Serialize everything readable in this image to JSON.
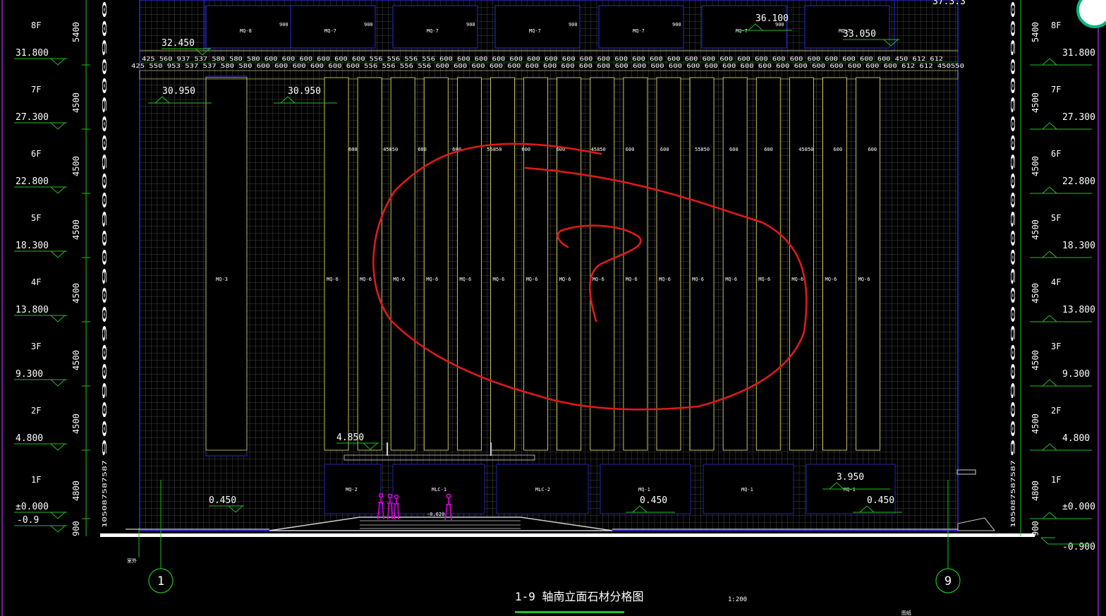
{
  "title": "1-9 轴南立面石材分格图",
  "scale": "1:200",
  "footer_note": "图纸",
  "north_label": "室外",
  "axes": [
    "1",
    "9"
  ],
  "floors": [
    {
      "name": "8F",
      "elev": "31.800",
      "height": "5400"
    },
    {
      "name": "7F",
      "elev": "27.300",
      "height": "4500"
    },
    {
      "name": "6F",
      "elev": "22.800",
      "height": "4500"
    },
    {
      "name": "5F",
      "elev": "18.300",
      "height": "4500"
    },
    {
      "name": "4F",
      "elev": "13.800",
      "height": "4500"
    },
    {
      "name": "3F",
      "elev": "9.300",
      "height": "4500"
    },
    {
      "name": "2F",
      "elev": "4.800",
      "height": "4500"
    },
    {
      "name": "1F",
      "elev": "±0.000",
      "height": "4800"
    }
  ],
  "base": {
    "left": "-0.9",
    "right": "-0.900",
    "height": "900"
  },
  "elev_marks": {
    "top_right": "36.100",
    "roof_right": "33.050",
    "roof_left": "32.450",
    "parapet_1": "30.950",
    "parapet_2": "30.950",
    "canopy": "4.850",
    "entry_right": "3.950",
    "sill_left": "0.450",
    "sill_mid": "0.450",
    "sill_right": "0.450",
    "entry_floor": "-0.020",
    "top_corner": "37.3.3"
  },
  "dim_row_1": "425 560 937 537 580 580 580 600 600 600 600 600 600 556 556 556 556 600 600 600 600 600 600 600 600 600 600 600 600 600 600 600 600 600 600 600 600 600 600 600 600 600 600 450 612 612",
  "dim_row_2": "425 550 953 537 537 580 580 600 600 600 600 600 600 556 556 556 556 600 600 600 600 600 600 600 600 600 600 600 600 600 600 600 600 600 600 600 600 600 600 600 600 600 600 612 612 450550",
  "top_panels": [
    {
      "tag": "MQ-8",
      "dim": "900"
    },
    {
      "tag": "MQ-7",
      "dim": "900"
    },
    {
      "tag": "MQ-7",
      "dim": "900"
    },
    {
      "tag": "MQ-7",
      "dim": "900"
    },
    {
      "tag": "MQ-7",
      "dim": "900"
    },
    {
      "tag": "MQ-7",
      "dim": "900"
    },
    {
      "tag": "MQ-7",
      "dim": ""
    }
  ],
  "strip_tags": [
    "MQ-3",
    "MQ-6",
    "MQ-6",
    "MQ-6",
    "MQ-6",
    "MQ-6",
    "MQ-6",
    "MQ-6",
    "MQ-6",
    "MQ-6",
    "MQ-6",
    "MQ-6",
    "MQ-6",
    "MQ-6",
    "MQ-6",
    "MQ-6",
    "MQ-6",
    "MQ-6"
  ],
  "strip_top_dims": [
    "600",
    "45850",
    "600",
    "600",
    "55850",
    "600",
    "600",
    "45850",
    "600",
    "600",
    "55850",
    "600",
    "600",
    "45850",
    "600",
    "600"
  ],
  "ground_tags": [
    "MQ-2",
    "MLC-1",
    "MLC-2",
    "MQ-1",
    "MQ-1",
    "MQ-1"
  ],
  "side_dims_left": "900900900900900900900900",
  "side_dims_right": "900900900900900900900900",
  "base_dim_left": "105087587587",
  "base_dim_right": "105087587587",
  "colors": {
    "background": "#000000",
    "grid_gray": "#5a5a5a",
    "stone_yellow": "#d6d66a",
    "outline_blue": "#2c2cd8",
    "dim_green": "#22c022",
    "annotation_red": "#e01a1a",
    "figure_magenta": "#e000e0",
    "frame_purple": "#8a2ad0"
  },
  "icons": [
    "north-marker-icon"
  ]
}
